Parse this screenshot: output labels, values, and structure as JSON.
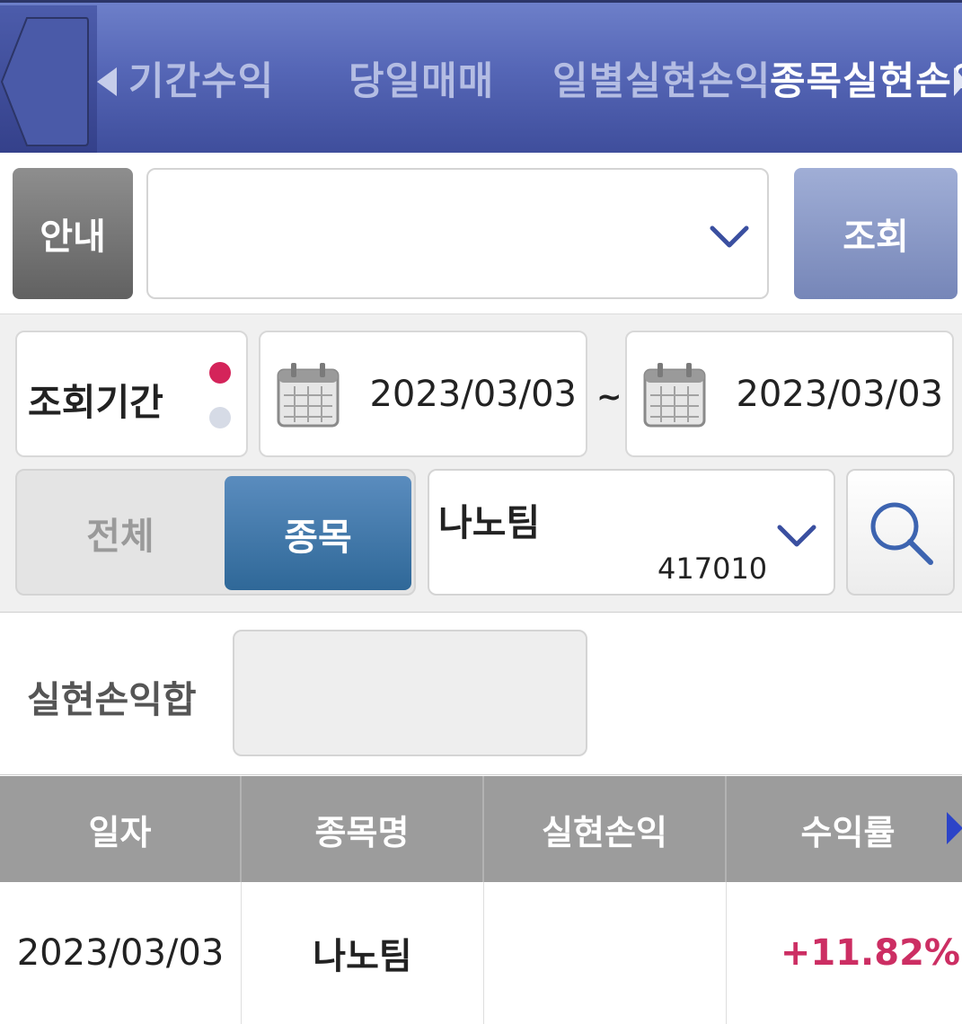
{
  "tabs": [
    {
      "label": "기간수익",
      "active": false
    },
    {
      "label": "당일매매",
      "active": false
    },
    {
      "label": "일별실현손익",
      "active": false
    },
    {
      "label": "종목실현손익",
      "active": true
    }
  ],
  "toolbar": {
    "info_label": "안내",
    "account_value": "",
    "query_label": "조회"
  },
  "filters": {
    "period_label": "조회기간",
    "date_from": "2023/03/03",
    "tilde": "~",
    "date_to": "2023/03/03",
    "segment_all": "전체",
    "segment_stock": "종목",
    "stock_name": "나노팀",
    "stock_code": "417010"
  },
  "summary": {
    "label": "실현손익합",
    "value": ""
  },
  "table": {
    "headers": [
      "일자",
      "종목명",
      "실현손익",
      "수익률"
    ],
    "rows": [
      {
        "date": "2023/03/03",
        "name": "나노팀",
        "pnl": "",
        "rate": "+11.82%"
      }
    ]
  },
  "colors": {
    "header_bar": "#5566b6",
    "active_segment": "#2f6898",
    "rate_positive": "#cc2e63"
  }
}
